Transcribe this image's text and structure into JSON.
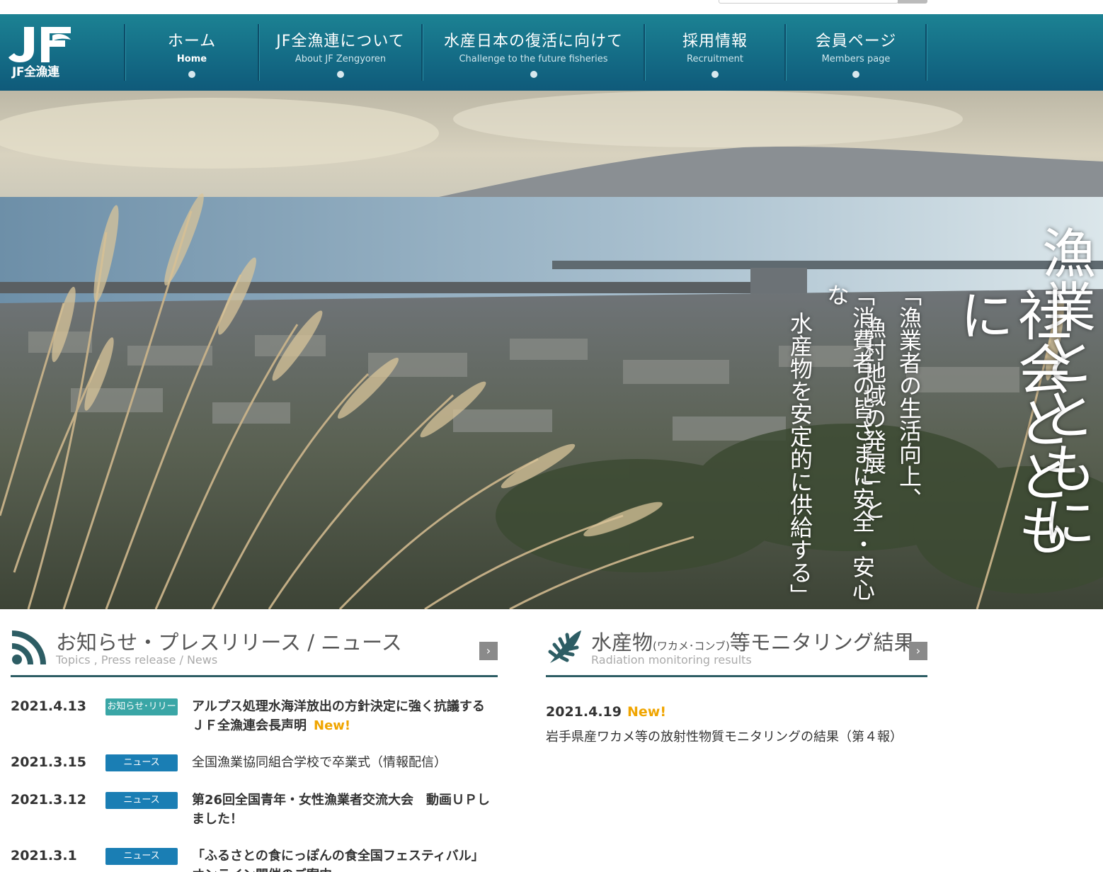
{
  "header": {
    "logo_text": "JF全漁連",
    "nav": [
      {
        "jp": "ホーム",
        "en": "Home"
      },
      {
        "jp": "JF全漁連について",
        "en": "About JF Zengyoren"
      },
      {
        "jp": "水産日本の復活に向けて",
        "en": "Challenge to the future fisheries"
      },
      {
        "jp": "採用情報",
        "en": "Recruitment"
      },
      {
        "jp": "会員ページ",
        "en": "Members page"
      }
    ]
  },
  "hero": {
    "main_line1": "漁業とともに",
    "main_line2": "社会とともに",
    "sub_line1": "「漁業者の生活向上、",
    "sub_line2": "漁村地域の発展」と",
    "sub_line3": "「消費者の皆さまに安全・安心な",
    "sub_line4": "水産物を安定的に供給する」"
  },
  "news": {
    "title": "お知らせ・プレスリリース / ニュース",
    "subtitle": "Topics , Press release / News",
    "arrow": "›",
    "items": [
      {
        "date": "2021.4.13",
        "badge": "お知らせ･リリース",
        "text": "アルプス処理水海洋放出の方針決定に強く抗議するＪＦ全漁連会長声明",
        "new": "New!"
      },
      {
        "date": "2021.3.15",
        "badge": "ニュース",
        "text": "全国漁業協同組合学校で卒業式（情報配信）"
      },
      {
        "date": "2021.3.12",
        "badge": "ニュース",
        "text": "第26回全国青年・女性漁業者交流大会　動画ＵＰしました！"
      },
      {
        "date": "2021.3.1",
        "badge": "ニュース",
        "text": "「ふるさとの食にっぽんの食全国フェスティバル」オンライン開催のご案内"
      }
    ]
  },
  "monitoring": {
    "title_main": "水産物",
    "title_small": "(ワカメ･コンブ)",
    "title_end": "等モニタリング結果",
    "subtitle": "Radiation monitoring results",
    "arrow": "›",
    "date": "2021.4.19",
    "new": "New!",
    "text": "岩手県産ワカメ等の放射性物質モニタリングの結果（第４報）"
  },
  "colors": {
    "header_top": "#1c8293",
    "header_bottom": "#0f5a7a",
    "badge_teal": "#3aa6a6",
    "badge_blue": "#1a7eb4",
    "new": "#f0a500",
    "rule": "#2d5d64"
  }
}
